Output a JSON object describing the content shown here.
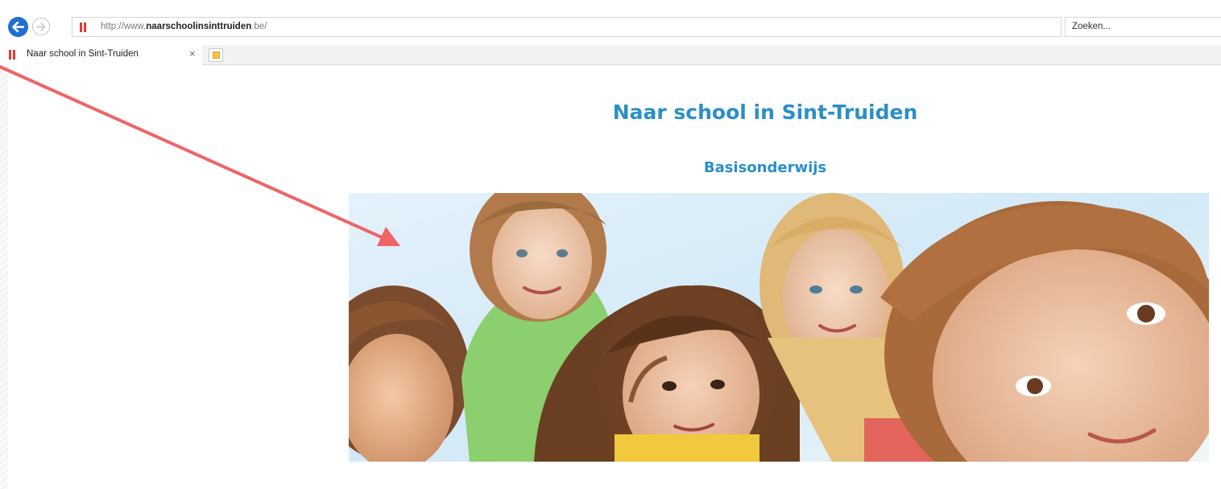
{
  "browser": {
    "url_prefix": "http://www.",
    "url_domain": "naarschoolinsinttruiden",
    "url_suffix": ".be/",
    "search_placeholder": "Zoeken...",
    "tab_title": "Naar school in Sint-Truiden",
    "tab_close": "×"
  },
  "page": {
    "title": "Naar school in Sint-Truiden",
    "subtitle": "Basisonderwijs",
    "hero_image": "children-group-photo"
  },
  "colors": {
    "heading": "#2a8fc9",
    "back_button": "#1f6fd1",
    "site_icon": "#e23b30",
    "annotation_arrow": "#f06466"
  }
}
